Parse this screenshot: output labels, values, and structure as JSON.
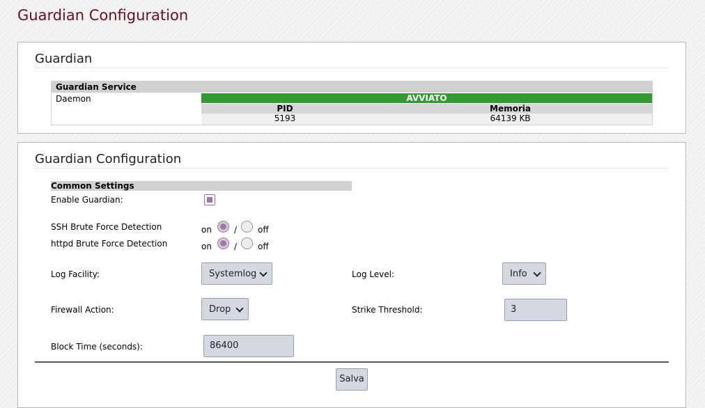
{
  "page": {
    "title": "Guardian Configuration"
  },
  "guardian_panel": {
    "title": "Guardian",
    "service_header": "Guardian Service",
    "service_name": "Daemon",
    "status": "AVVIATO",
    "status_color": "#339933",
    "columns": [
      "PID",
      "Memoria"
    ],
    "values": [
      "5193",
      "64139 KB"
    ]
  },
  "config_panel": {
    "title": "Guardian Configuration",
    "common_settings_label": "Common Settings",
    "enable_guardian": {
      "label": "Enable Guardian:",
      "checked": true
    },
    "ssh_detection": {
      "label": "SSH Brute Force Detection",
      "on_label": "on",
      "separator": "/",
      "off_label": "off",
      "selected": "on"
    },
    "httpd_detection": {
      "label": "httpd Brute Force Detection",
      "on_label": "on",
      "separator": "/",
      "off_label": "off",
      "selected": "on"
    },
    "log_facility": {
      "label": "Log Facility:",
      "value": "Systemlog"
    },
    "log_level": {
      "label": "Log Level:",
      "value": "Info"
    },
    "firewall_action": {
      "label": "Firewall Action:",
      "value": "Drop"
    },
    "strike_threshold": {
      "label": "Strike Threshold:",
      "value": "3"
    },
    "block_time": {
      "label": "Block Time (seconds):",
      "value": "86400"
    },
    "save_label": "Salva"
  },
  "colors": {
    "title": "#6b0f1a",
    "accent": "#9e78a8",
    "input_bg": "#d4d8e2"
  }
}
